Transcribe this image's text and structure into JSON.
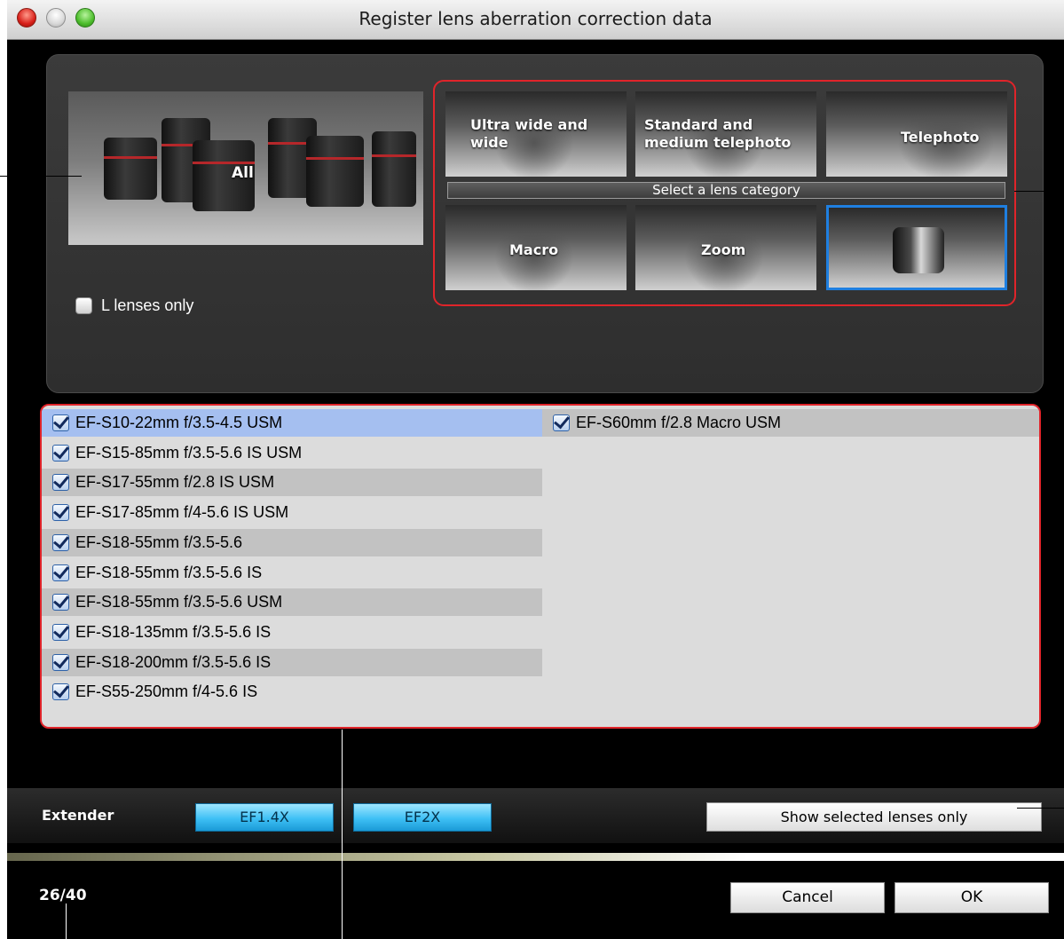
{
  "window": {
    "title": "Register lens aberration correction data"
  },
  "lens_selection": {
    "all_label": "All",
    "l_lenses_only_label": "L lenses only",
    "l_lenses_only_checked": false
  },
  "category": {
    "ultra_wide_label": "Ultra wide and wide",
    "standard_label": "Standard and medium telephoto",
    "telephoto_label": "Telephoto",
    "macro_label": "Macro",
    "zoom_label": "Zoom",
    "divider_text": "Select a lens category",
    "selected": "EF-S lens (icon)"
  },
  "lens_list": {
    "column1": [
      {
        "name": "EF-S10-22mm f/3.5-4.5 USM",
        "checked": true
      },
      {
        "name": "EF-S15-85mm f/3.5-5.6 IS USM",
        "checked": true
      },
      {
        "name": "EF-S17-55mm f/2.8 IS USM",
        "checked": true
      },
      {
        "name": "EF-S17-85mm f/4-5.6 IS USM",
        "checked": true
      },
      {
        "name": "EF-S18-55mm f/3.5-5.6",
        "checked": true
      },
      {
        "name": "EF-S18-55mm f/3.5-5.6 IS",
        "checked": true
      },
      {
        "name": "EF-S18-55mm f/3.5-5.6 USM",
        "checked": true
      },
      {
        "name": "EF-S18-135mm f/3.5-5.6 IS",
        "checked": true
      },
      {
        "name": "EF-S18-200mm f/3.5-5.6 IS",
        "checked": true
      },
      {
        "name": "EF-S55-250mm f/4-5.6 IS",
        "checked": true
      }
    ],
    "column2": [
      {
        "name": "EF-S60mm f/2.8 Macro USM",
        "checked": true
      }
    ]
  },
  "extender": {
    "label": "Extender",
    "btn_14x": "EF1.4X",
    "btn_2x": "EF2X"
  },
  "show_selected_label": "Show selected lenses only",
  "counter": "26/40",
  "buttons": {
    "cancel": "Cancel",
    "ok": "OK"
  },
  "colors": {
    "highlight_frame": "#e0242a",
    "selected_row": "#a5bff0",
    "selection_border": "#1f7fe0"
  }
}
